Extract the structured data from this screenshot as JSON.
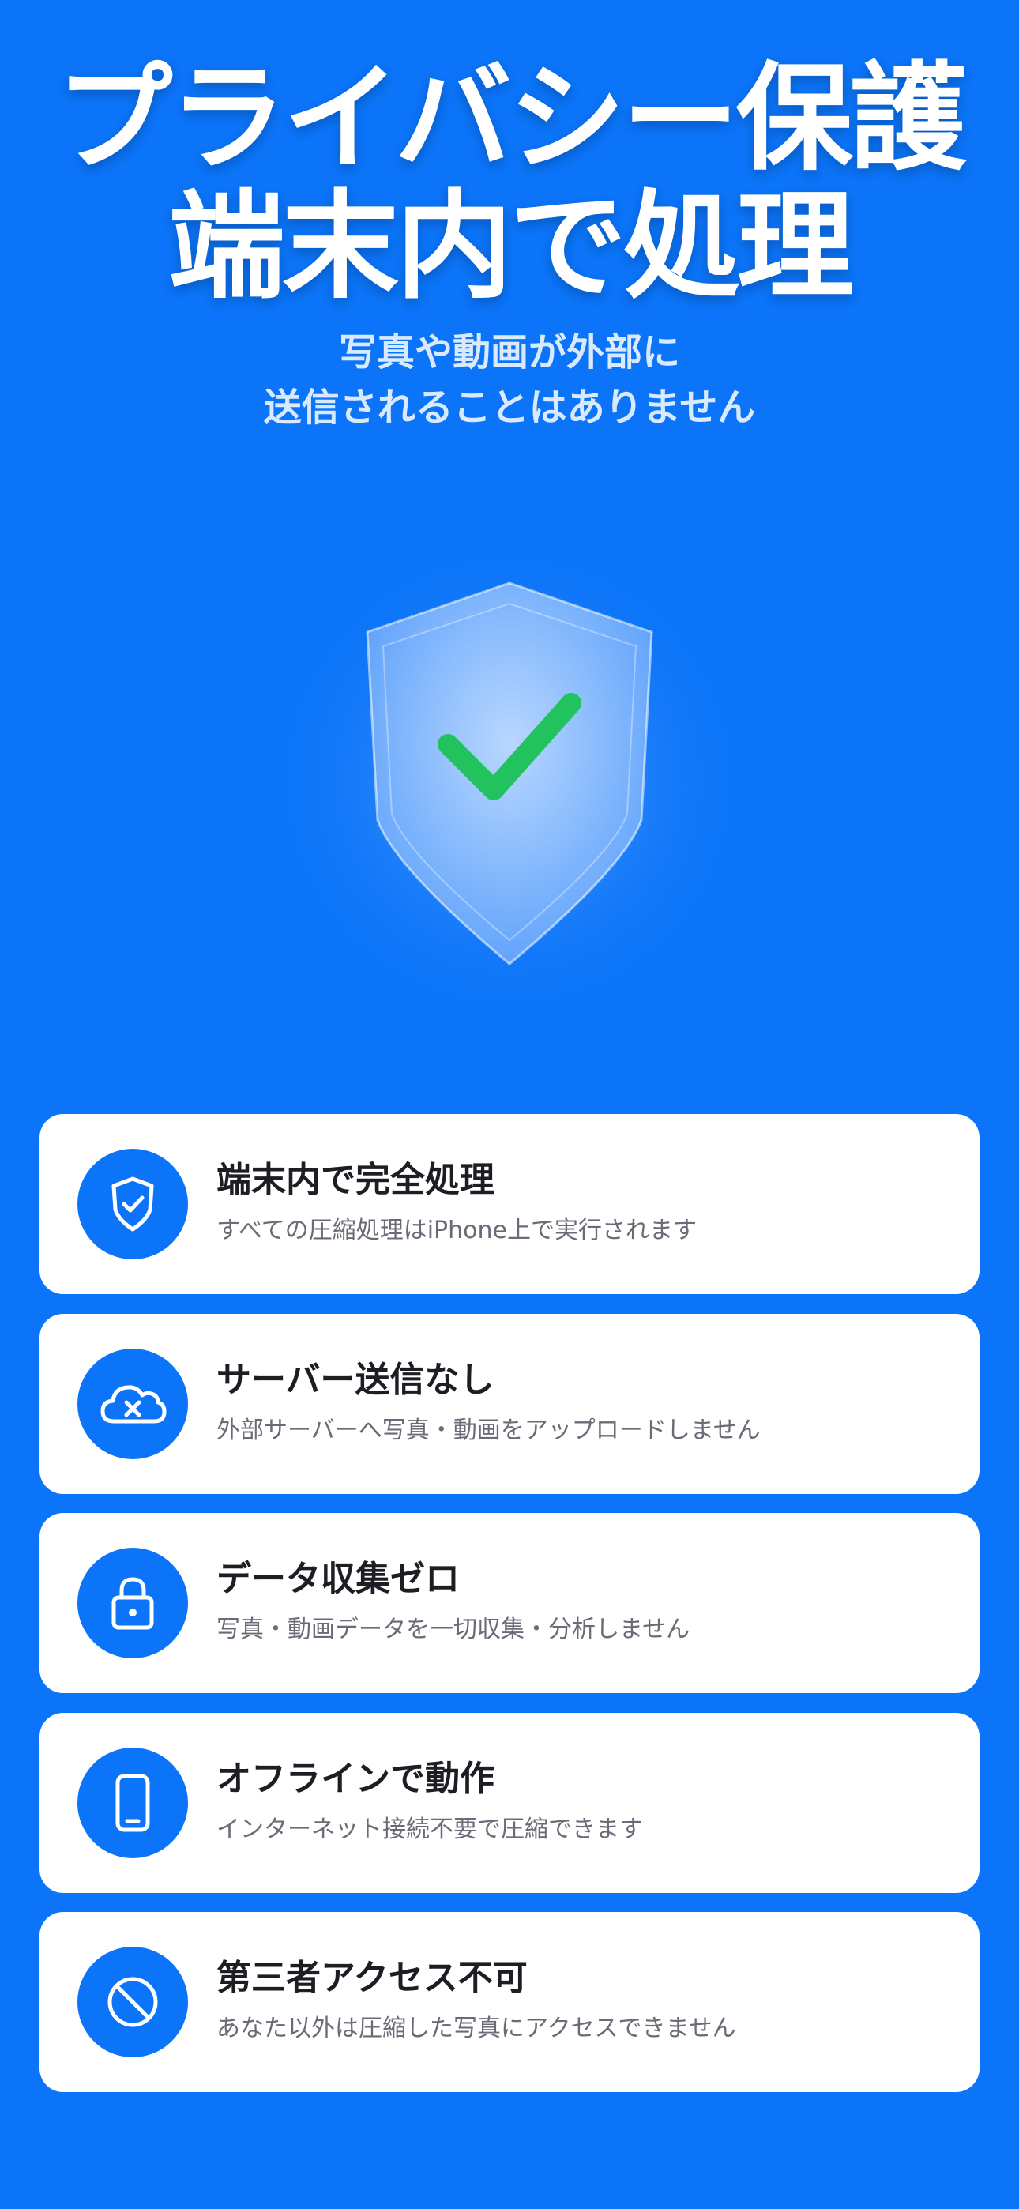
{
  "hero": {
    "title_line1": "プライバシー保護",
    "title_line2": "端末内で処理",
    "subtitle_line1": "写真や動画が外部に",
    "subtitle_line2": "送信されることはありません"
  },
  "colors": {
    "background": "#0B74F8",
    "card": "#FFFFFF",
    "check": "#22C35E"
  },
  "features": [
    {
      "icon": "shield-check-icon",
      "title": "端末内で完全処理",
      "desc": "すべての圧縮処理はiPhone上で実行されます"
    },
    {
      "icon": "cloud-x-icon",
      "title": "サーバー送信なし",
      "desc": "外部サーバーへ写真・動画をアップロードしません"
    },
    {
      "icon": "lock-icon",
      "title": "データ収集ゼロ",
      "desc": "写真・動画データを一切収集・分析しません"
    },
    {
      "icon": "smartphone-icon",
      "title": "オフラインで動作",
      "desc": "インターネット接続不要で圧縮できます"
    },
    {
      "icon": "prohibited-icon",
      "title": "第三者アクセス不可",
      "desc": "あなた以外は圧縮した写真にアクセスできません"
    }
  ]
}
